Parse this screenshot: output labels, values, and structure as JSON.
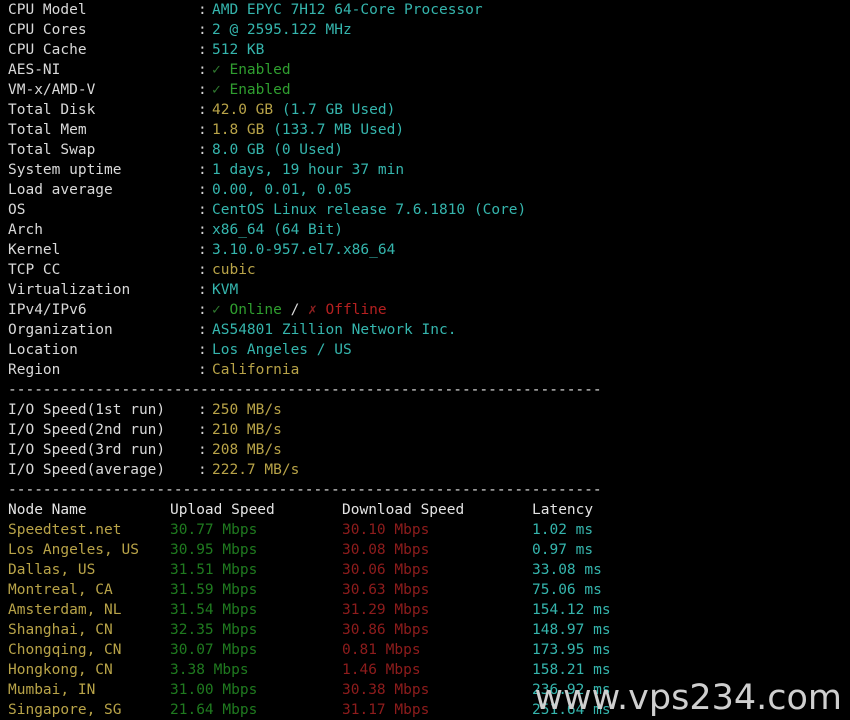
{
  "terminal": {
    "background_color": "#000000",
    "text_color": "#d9d9d9",
    "value_color": "#35b5ad",
    "highlight_color": "#b8a348",
    "ok_color": "#2f9e2f",
    "bad_color": "#b52020",
    "upload_color": "#1f7a1f",
    "download_color": "#8e1c1c",
    "latency_color": "#35b5ad",
    "separator": "--------------------------------------------------------------------",
    "colon": ":"
  },
  "system_info": [
    {
      "label": "CPU Model",
      "value": "AMD EPYC 7H12 64-Core Processor",
      "style": "cyan"
    },
    {
      "label": "CPU Cores",
      "value": "2 @ 2595.122 MHz",
      "style": "cyan"
    },
    {
      "label": "CPU Cache",
      "value": "512 KB",
      "style": "cyan"
    },
    {
      "label": "AES-NI",
      "value": "Enabled",
      "mark": "✓",
      "style": "ok"
    },
    {
      "label": "VM-x/AMD-V",
      "value": "Enabled",
      "mark": "✓",
      "style": "ok"
    },
    {
      "label": "Total Disk",
      "value": "42.0 GB",
      "extra": " (1.7 GB Used)",
      "style": "yellow-cyan"
    },
    {
      "label": "Total Mem",
      "value": "1.8 GB",
      "extra": " (133.7 MB Used)",
      "style": "yellow-cyan"
    },
    {
      "label": "Total Swap",
      "value": "8.0 GB (0 Used)",
      "style": "cyan"
    },
    {
      "label": "System uptime",
      "value": "1 days, 19 hour 37 min",
      "style": "cyan"
    },
    {
      "label": "Load average",
      "value": "0.00, 0.01, 0.05",
      "style": "cyan"
    },
    {
      "label": "OS",
      "value": "CentOS Linux release 7.6.1810 (Core)",
      "style": "cyan"
    },
    {
      "label": "Arch",
      "value": "x86_64 (64 Bit)",
      "style": "cyan"
    },
    {
      "label": "Kernel",
      "value": "3.10.0-957.el7.x86_64",
      "style": "cyan"
    },
    {
      "label": "TCP CC",
      "value": "cubic",
      "style": "yellow"
    },
    {
      "label": "Virtualization",
      "value": "KVM",
      "style": "cyan"
    },
    {
      "label": "IPv4/IPv6",
      "value_ok": "Online",
      "mark_ok": "✓",
      "value_bad": "Offline",
      "mark_bad": "✗",
      "sep": " / ",
      "style": "online-offline"
    },
    {
      "label": "Organization",
      "value": "AS54801 Zillion Network Inc.",
      "style": "cyan"
    },
    {
      "label": "Location",
      "value": "Los Angeles / US",
      "style": "cyan"
    },
    {
      "label": "Region",
      "value": "California",
      "style": "yellow"
    }
  ],
  "io_speed": [
    {
      "label": "I/O Speed(1st run)",
      "value": "250 MB/s"
    },
    {
      "label": "I/O Speed(2nd run)",
      "value": "210 MB/s"
    },
    {
      "label": "I/O Speed(3rd run)",
      "value": "208 MB/s"
    },
    {
      "label": "I/O Speed(average)",
      "value": "222.7 MB/s"
    }
  ],
  "speedtest": {
    "headers": [
      "Node Name",
      "Upload Speed",
      "Download Speed",
      "Latency"
    ],
    "rows": [
      {
        "node": "Speedtest.net",
        "upload": "30.77 Mbps",
        "download": "30.10 Mbps",
        "latency": "1.02 ms"
      },
      {
        "node": "Los Angeles, US",
        "upload": "30.95 Mbps",
        "download": "30.08 Mbps",
        "latency": "0.97 ms"
      },
      {
        "node": "Dallas, US",
        "upload": "31.51 Mbps",
        "download": "30.06 Mbps",
        "latency": "33.08 ms"
      },
      {
        "node": "Montreal, CA",
        "upload": "31.59 Mbps",
        "download": "30.63 Mbps",
        "latency": "75.06 ms"
      },
      {
        "node": "Amsterdam, NL",
        "upload": "31.54 Mbps",
        "download": "31.29 Mbps",
        "latency": "154.12 ms"
      },
      {
        "node": "Shanghai, CN",
        "upload": "32.35 Mbps",
        "download": "30.86 Mbps",
        "latency": "148.97 ms"
      },
      {
        "node": "Chongqing, CN",
        "upload": "30.07 Mbps",
        "download": "0.81 Mbps",
        "latency": "173.95 ms"
      },
      {
        "node": "Hongkong, CN",
        "upload": "3.38 Mbps",
        "download": "1.46 Mbps",
        "latency": "158.21 ms"
      },
      {
        "node": "Mumbai, IN",
        "upload": "31.00 Mbps",
        "download": "30.38 Mbps",
        "latency": "236.92 ms"
      },
      {
        "node": "Singapore, SG",
        "upload": "21.64 Mbps",
        "download": "31.17 Mbps",
        "latency": "251.64 ms"
      }
    ]
  },
  "watermark": {
    "text": "www.vps234.com"
  }
}
